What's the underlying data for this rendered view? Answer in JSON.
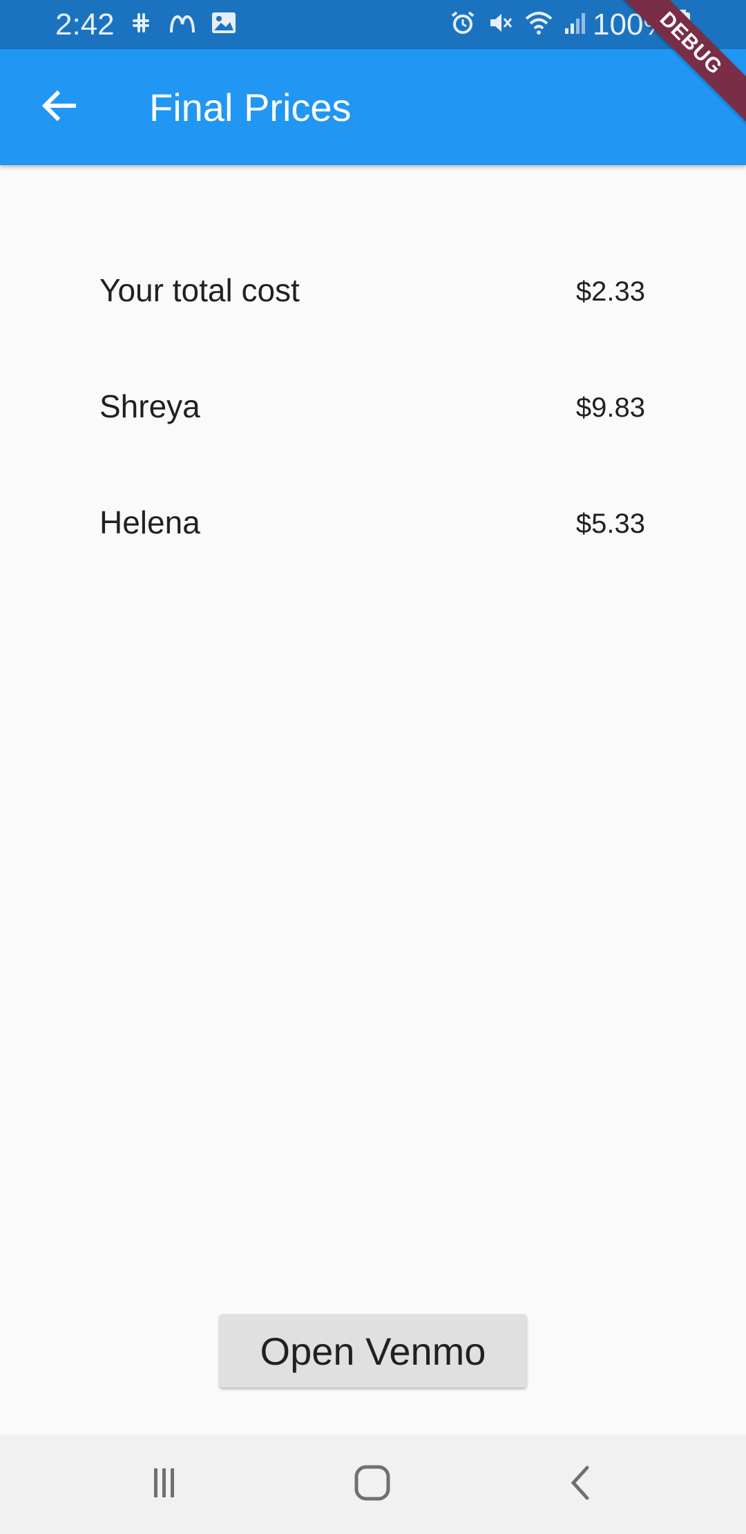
{
  "status_bar": {
    "time": "2:42",
    "battery": "100%",
    "left_icons": [
      "slack-icon",
      "mcdonalds-icon",
      "image-icon"
    ],
    "right_icons": [
      "alarm-icon",
      "mute-icon",
      "wifi-icon",
      "signal-icon",
      "battery-icon"
    ]
  },
  "app_bar": {
    "title": "Final Prices",
    "color": "#2196f3",
    "back_icon": "arrow-back-icon"
  },
  "debug_banner": "DEBUG",
  "prices": [
    {
      "name": "Your total cost",
      "amount": "$2.33"
    },
    {
      "name": "Shreya",
      "amount": "$9.83"
    },
    {
      "name": "Helena",
      "amount": "$5.33"
    }
  ],
  "venmo_button": {
    "label": "Open Venmo"
  },
  "nav_bar": {
    "buttons": [
      "recent-apps-icon",
      "home-icon",
      "back-icon"
    ]
  }
}
